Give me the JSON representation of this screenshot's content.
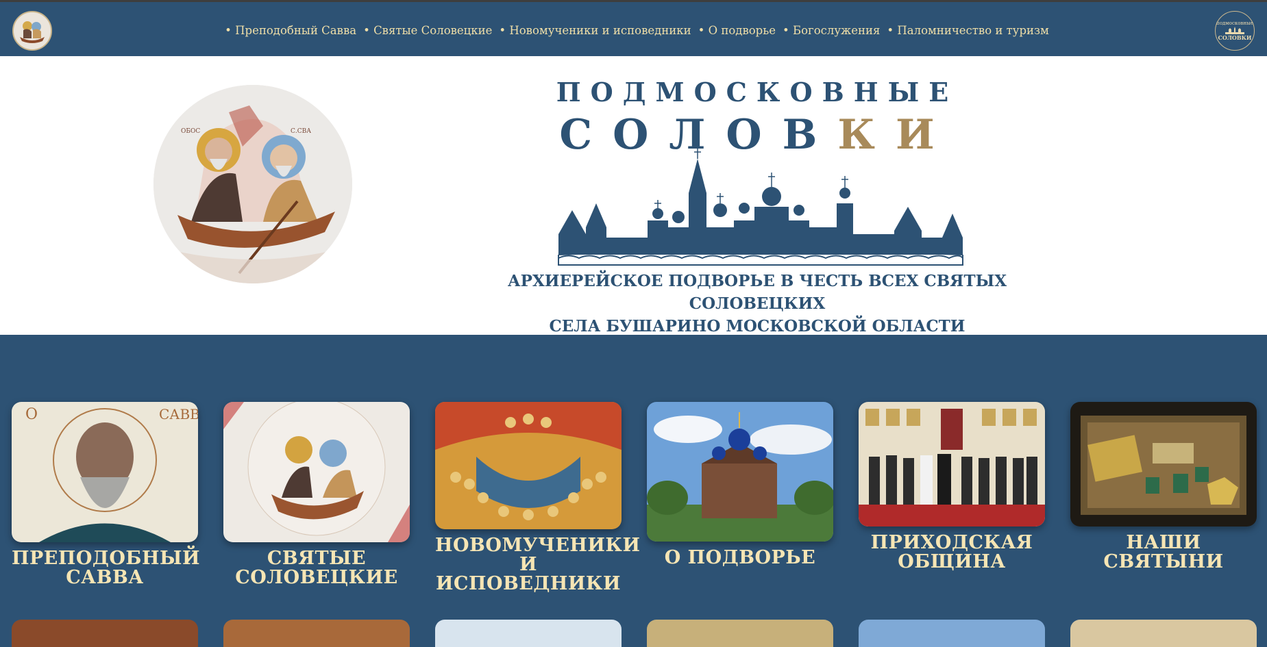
{
  "nav": {
    "items": [
      {
        "label": "Преподобный Савва"
      },
      {
        "label": "Святые Соловецкие"
      },
      {
        "label": "Новомученики и исповедники"
      },
      {
        "label": "О подворье"
      },
      {
        "label": "Богослужения"
      },
      {
        "label": "Паломничество и туризм"
      }
    ],
    "right_logo_top": "подмосковные",
    "right_logo_bottom": "СОЛОВКИ"
  },
  "hero": {
    "title_line1": "ПОДМОСКОВНЫЕ",
    "title_line2_a": "СОЛОВ",
    "title_line2_b": "КИ",
    "subtitle_line1": "АРХИЕРЕЙСКОЕ ПОДВОРЬЕ В ЧЕСТЬ ВСЕХ СВЯТЫХ СОЛОВЕЦКИХ",
    "subtitle_line2": "СЕЛА БУШАРИНО МОСКОВСКОЙ ОБЛАСТИ"
  },
  "cards": [
    {
      "label": "ПРЕПОДОБНЫЙ САВВА"
    },
    {
      "label": "СВЯТЫЕ СОЛОВЕЦКИЕ"
    },
    {
      "label": "НОВОМУЧЕНИКИ И ИСПОВЕДНИКИ"
    },
    {
      "label": "О ПОДВОРЬЕ"
    },
    {
      "label": "ПРИХОДСКАЯ ОБЩИНА"
    },
    {
      "label": "НАШИ СВЯТЫНИ"
    }
  ],
  "colors": {
    "brand_blue": "#2d5274",
    "gold_text": "#f0dfa8",
    "title_gold": "#a88a5a"
  }
}
